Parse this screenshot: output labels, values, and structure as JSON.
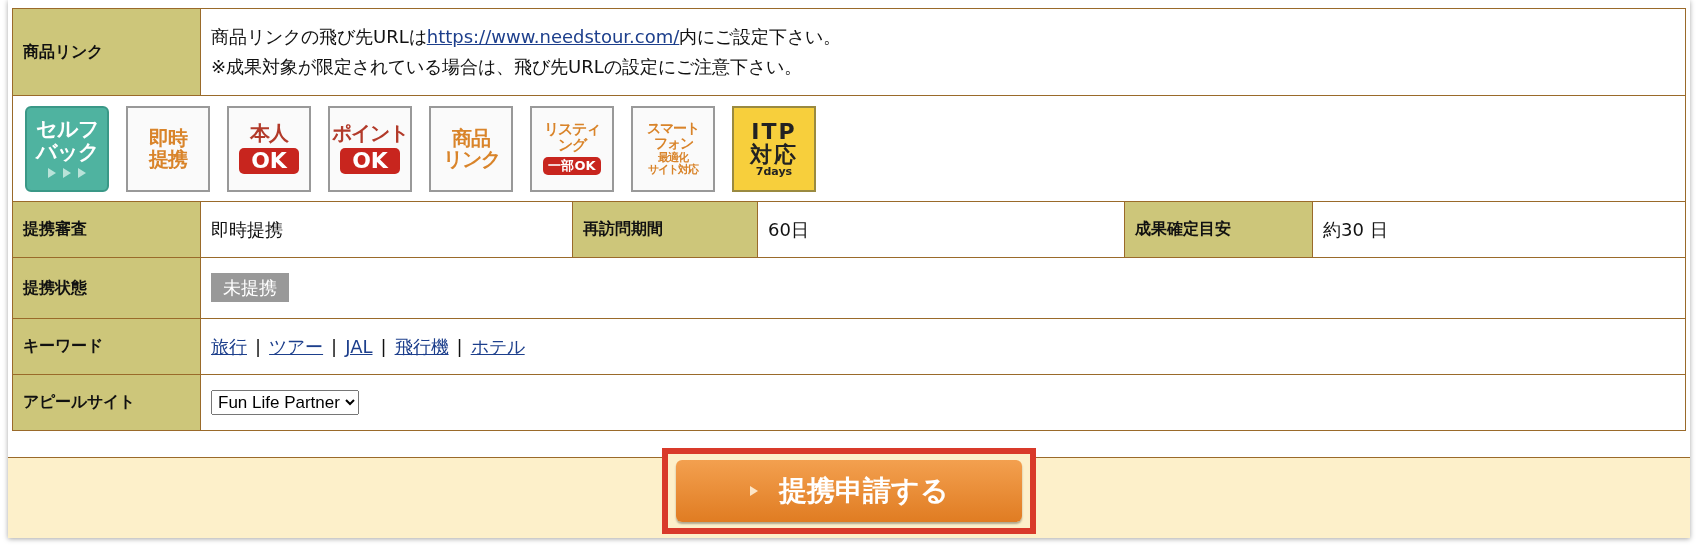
{
  "product_link": {
    "label": "商品リンク",
    "line1_before": "商品リンクの飛び先URLは",
    "url": "https://www.needstour.com/",
    "line1_after": "内にご設定下さい。",
    "line2": "※成果対象が限定されている場合は、飛び先URLの設定にご注意下さい。"
  },
  "badges": [
    {
      "kind": "teal",
      "lines": [
        "セルフ",
        "バック"
      ]
    },
    {
      "kind": "plain",
      "lines": [
        "即時",
        "提携"
      ]
    },
    {
      "kind": "pill",
      "lines": [
        "本人"
      ],
      "pill": "OK"
    },
    {
      "kind": "pill",
      "lines": [
        "ポイント"
      ],
      "pill": "OK"
    },
    {
      "kind": "plain",
      "lines": [
        "商品",
        "リンク"
      ]
    },
    {
      "kind": "pill",
      "lines": [
        "リスティ",
        "ング"
      ],
      "pill": "一部OK"
    },
    {
      "kind": "small",
      "lines": [
        "スマート",
        "フォン",
        "最適化",
        "サイト対応"
      ]
    },
    {
      "kind": "itp",
      "lines": [
        "ITP",
        "対応"
      ],
      "sub": "7days"
    }
  ],
  "review": [
    {
      "label": "提携審査",
      "value": "即時提携"
    },
    {
      "label": "再訪問期間",
      "value": "60日"
    },
    {
      "label": "成果確定目安",
      "value": "約30 日"
    }
  ],
  "status": {
    "label": "提携状態",
    "value": "未提携"
  },
  "keywords": {
    "label": "キーワード",
    "separator": "|",
    "items": [
      "旅行",
      "ツアー",
      "JAL",
      "飛行機",
      "ホテル"
    ]
  },
  "appeal_site": {
    "label": "アピールサイト",
    "value": "Fun Life Partner"
  },
  "apply_button": {
    "label": "提携申請する"
  }
}
